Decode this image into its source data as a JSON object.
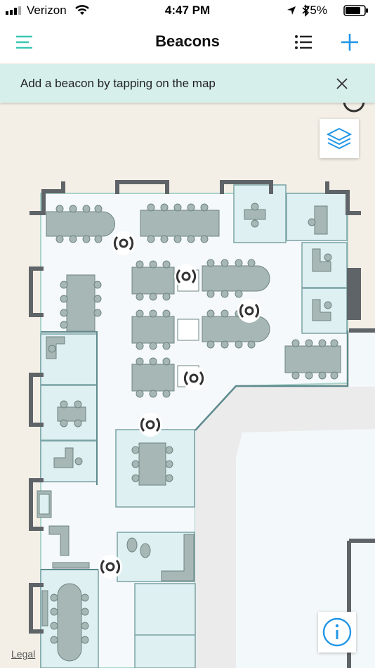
{
  "status_bar": {
    "carrier": "Verizon",
    "time": "4:47 PM",
    "battery": "75%"
  },
  "nav": {
    "title": "Beacons",
    "menu_icon": "hamburger-menu-icon",
    "list_icon": "list-icon",
    "add_icon": "plus-icon"
  },
  "banner": {
    "message": "Add a beacon by tapping on the map",
    "close_icon": "close-icon"
  },
  "map": {
    "layers_icon": "layers-icon",
    "info_icon": "info-icon",
    "legal": "Legal",
    "beacon_count": 7
  },
  "colors": {
    "accent": "#2196e6",
    "menu_teal": "#3cc7b5",
    "banner_bg": "#d6efea",
    "floor": "#f6f9fb",
    "room": "#dff0f2",
    "wall": "#5f6468",
    "furniture": "#a7b7b5"
  }
}
